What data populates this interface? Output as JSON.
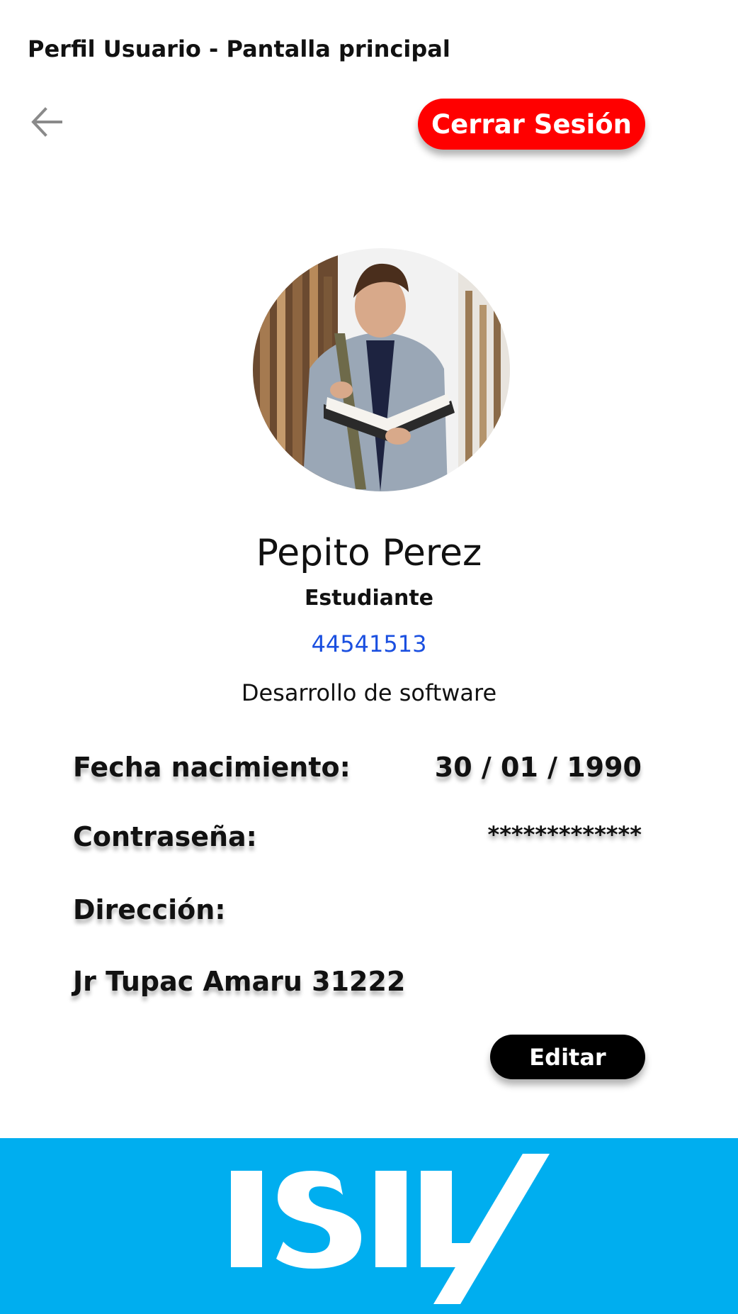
{
  "header": {
    "title": "Perfil Usuario - Pantalla principal"
  },
  "toolbar": {
    "back_icon": "arrow-left-icon",
    "logout_label": "Cerrar Sesión",
    "logout_color": "#ff0000"
  },
  "profile": {
    "name": "Pepito Perez",
    "role": "Estudiante",
    "code": "44541513",
    "code_color": "#1a4fe0",
    "career": "Desarrollo de software"
  },
  "details": {
    "birthdate_label": "Fecha nacimiento:",
    "birthdate_value": "30 / 01 / 1990",
    "password_label": "Contraseña:",
    "password_value": "*************",
    "address_label": "Dirección:",
    "address_value": "Jr Tupac Amaru 31222"
  },
  "actions": {
    "edit_label": "Editar"
  },
  "footer": {
    "brand": "ISIL",
    "color": "#00aeef"
  }
}
